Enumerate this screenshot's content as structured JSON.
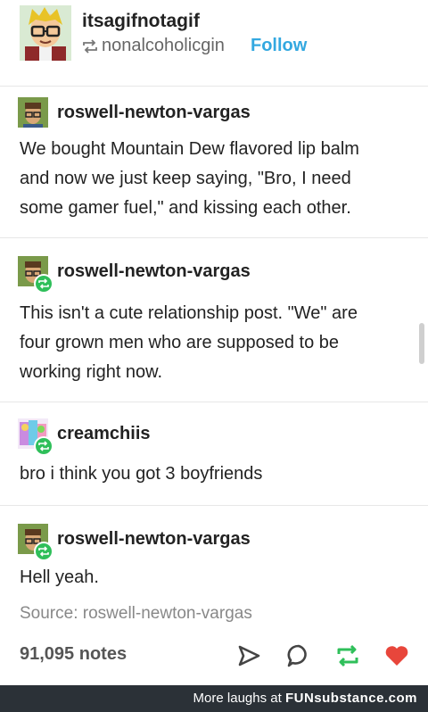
{
  "header": {
    "op_username": "itsagifnotagif",
    "reblogged_from": "nonalcoholicgin",
    "follow_label": "Follow"
  },
  "thread": [
    {
      "username": "roswell-newton-vargas",
      "text_lines": [
        "We bought Mountain Dew flavored lip balm",
        "and now we just keep saying, \"Bro, I need",
        "some gamer fuel,\" and kissing each other."
      ]
    },
    {
      "username": "roswell-newton-vargas",
      "text_lines": [
        "This isn't a cute relationship post. \"We\" are",
        "four grown men who are supposed to be",
        "working right now."
      ]
    },
    {
      "username": "creamchiis",
      "text_lines": [
        "bro i think you got 3 boyfriends"
      ]
    },
    {
      "username": "roswell-newton-vargas",
      "text_lines": [
        "Hell yeah."
      ]
    }
  ],
  "source": {
    "label": "Source: roswell-newton-vargas"
  },
  "footer": {
    "notes": "91,095 notes",
    "icons": [
      "send-icon",
      "comment-icon",
      "reblog-icon",
      "heart-icon"
    ],
    "colors": {
      "reblog": "#2fbf5a",
      "heart": "#e8463b"
    }
  },
  "banner": {
    "prefix": "More laughs at",
    "brand": "FUNsubstance.com"
  },
  "colors": {
    "follow": "#33a8e0",
    "badge": "#2fbf5a",
    "banner_bg": "#2b3137"
  }
}
